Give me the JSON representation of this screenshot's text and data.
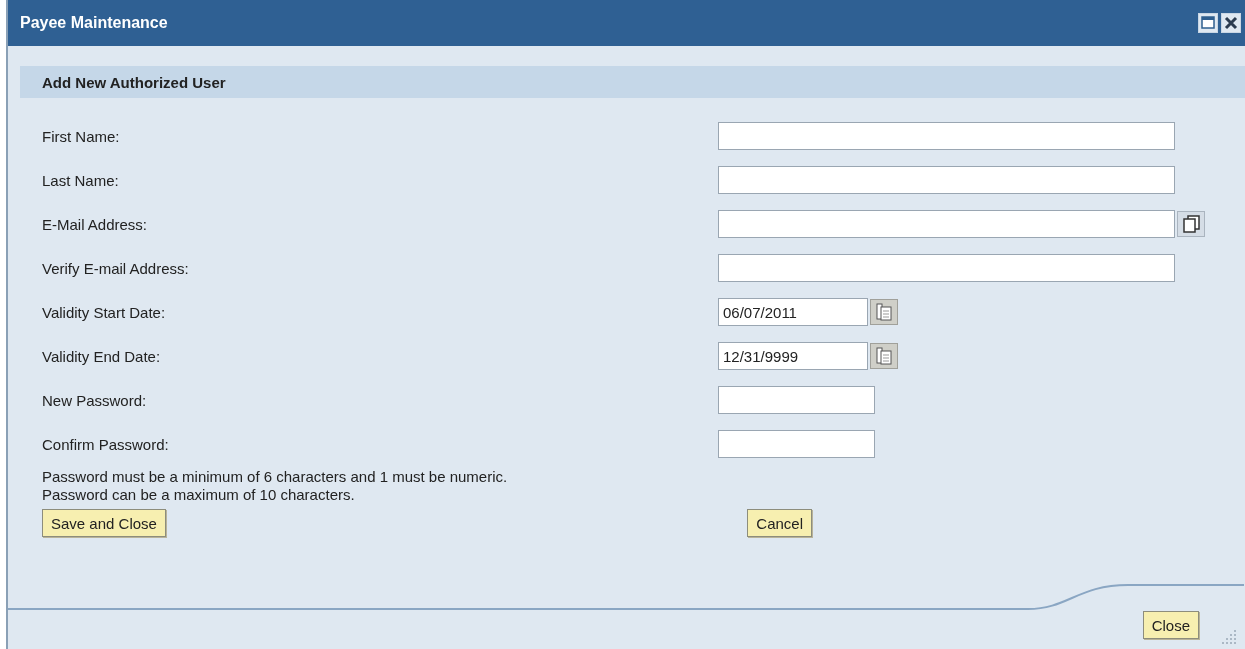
{
  "window": {
    "title": "Payee Maintenance"
  },
  "section": {
    "title": "Add New Authorized User"
  },
  "fields": [
    {
      "label": "First Name:",
      "kind": "long"
    },
    {
      "label": "Last Name:",
      "kind": "long"
    },
    {
      "label": "E-Mail Address:",
      "kind": "long_help"
    },
    {
      "label": "Verify E-mail Address:",
      "kind": "long"
    },
    {
      "label": "Validity Start Date:",
      "kind": "date",
      "value": "06/07/2011"
    },
    {
      "label": "Validity End Date:",
      "kind": "date",
      "value": "12/31/9999"
    },
    {
      "label": "New Password:",
      "kind": "short"
    },
    {
      "label": "Confirm Password:",
      "kind": "short"
    }
  ],
  "notes": [
    "Password must be a minimum of 6 characters and 1 must be numeric.",
    "Password can be a maximum of 10 characters."
  ],
  "buttons": {
    "save": "Save and Close",
    "cancel": "Cancel"
  },
  "footer": {
    "close": "Close"
  }
}
